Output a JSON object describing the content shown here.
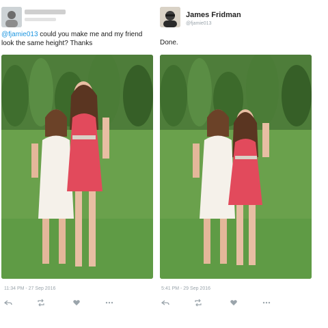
{
  "left_tweet": {
    "text_mention": "@fjamie013",
    "text_body": " could you make me and my friend look the same height? Thanks",
    "timestamp": "11:34 PM - 27 Sep 2016"
  },
  "right_tweet": {
    "author_name": "James Fridman",
    "author_handle": "@fjamie013",
    "text": "Done.",
    "timestamp": "5:41 PM - 29 Sep 2016"
  },
  "icons": [
    "reply-icon",
    "retweet-icon",
    "like-icon",
    "more-icon"
  ],
  "colors": {
    "link": "#1b95e0",
    "muted": "#9aa4ab",
    "grass": "#5f9b45",
    "red_dress": "#e24a5c"
  }
}
